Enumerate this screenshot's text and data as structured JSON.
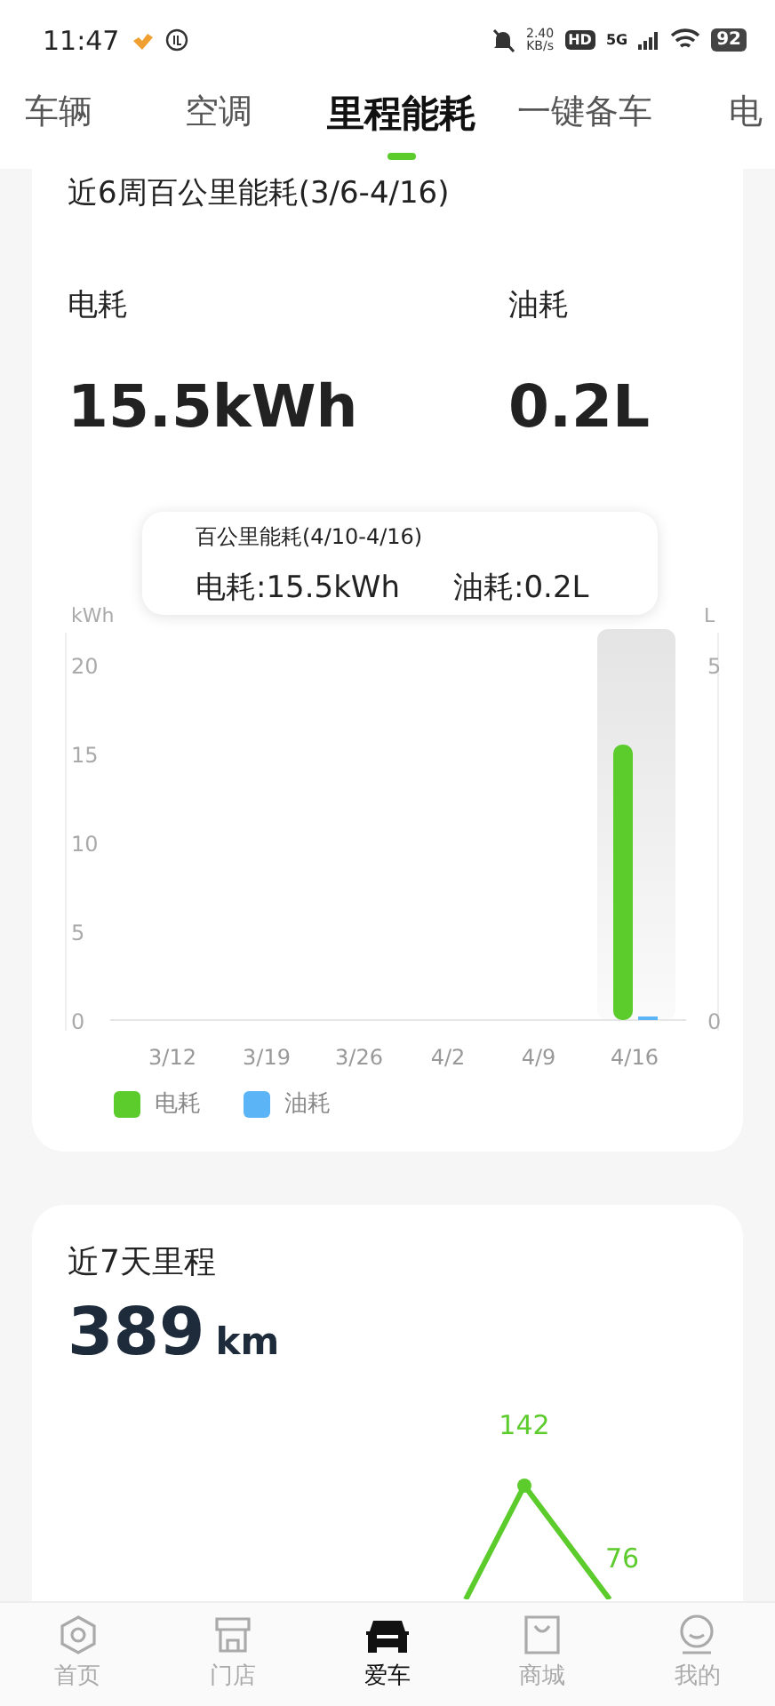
{
  "status_bar": {
    "time": "11:47",
    "net_speed": "2.40",
    "net_unit": "KB/s",
    "hd": "HD",
    "network": "5G",
    "battery": "92"
  },
  "tabs": [
    {
      "label": "车辆",
      "selected": false
    },
    {
      "label": "空调",
      "selected": false
    },
    {
      "label": "里程能耗",
      "selected": true
    },
    {
      "label": "一键备车",
      "selected": false
    },
    {
      "label": "电",
      "selected": false
    }
  ],
  "energy_card": {
    "title": "近6周百公里能耗(3/6-4/16)",
    "stats": [
      {
        "label": "电耗",
        "value": "15.5kWh"
      },
      {
        "label": "油耗",
        "value": "0.2L"
      }
    ],
    "tooltip": {
      "title": "百公里能耗(4/10-4/16)",
      "entries": [
        "电耗:15.5kWh",
        "油耗:0.2L"
      ]
    },
    "right_axis": {
      "unit": "L",
      "ticks": [
        "5",
        "0"
      ]
    },
    "chart_data": {
      "type": "bar",
      "categories": [
        "3/12",
        "3/19",
        "3/26",
        "4/2",
        "4/9",
        "4/16"
      ],
      "ylabel": "kWh",
      "ylim": [
        0,
        20
      ],
      "yticks": [
        0,
        5,
        10,
        15,
        20
      ],
      "series": [
        {
          "name": "电耗",
          "color": "#5ccb2c",
          "values": [
            0,
            0,
            0,
            0,
            0,
            15.5
          ]
        },
        {
          "name": "油耗",
          "color": "#5ab4f5",
          "values": [
            0,
            0,
            0,
            0,
            0,
            0.2
          ]
        }
      ],
      "annotations": [
        {
          "x": "4/16"
        }
      ]
    }
  },
  "mileage_card": {
    "title": "近7天里程",
    "value": "389",
    "unit": "km",
    "point_labels": [
      "142",
      "76"
    ]
  },
  "nav": [
    {
      "label": "首页",
      "kind": "hexagon",
      "selected": false
    },
    {
      "label": "门店",
      "kind": "store",
      "selected": false
    },
    {
      "label": "爱车",
      "kind": "car",
      "selected": true
    },
    {
      "label": "商城",
      "kind": "bag",
      "selected": false
    },
    {
      "label": "我的",
      "kind": "person",
      "selected": false
    }
  ]
}
